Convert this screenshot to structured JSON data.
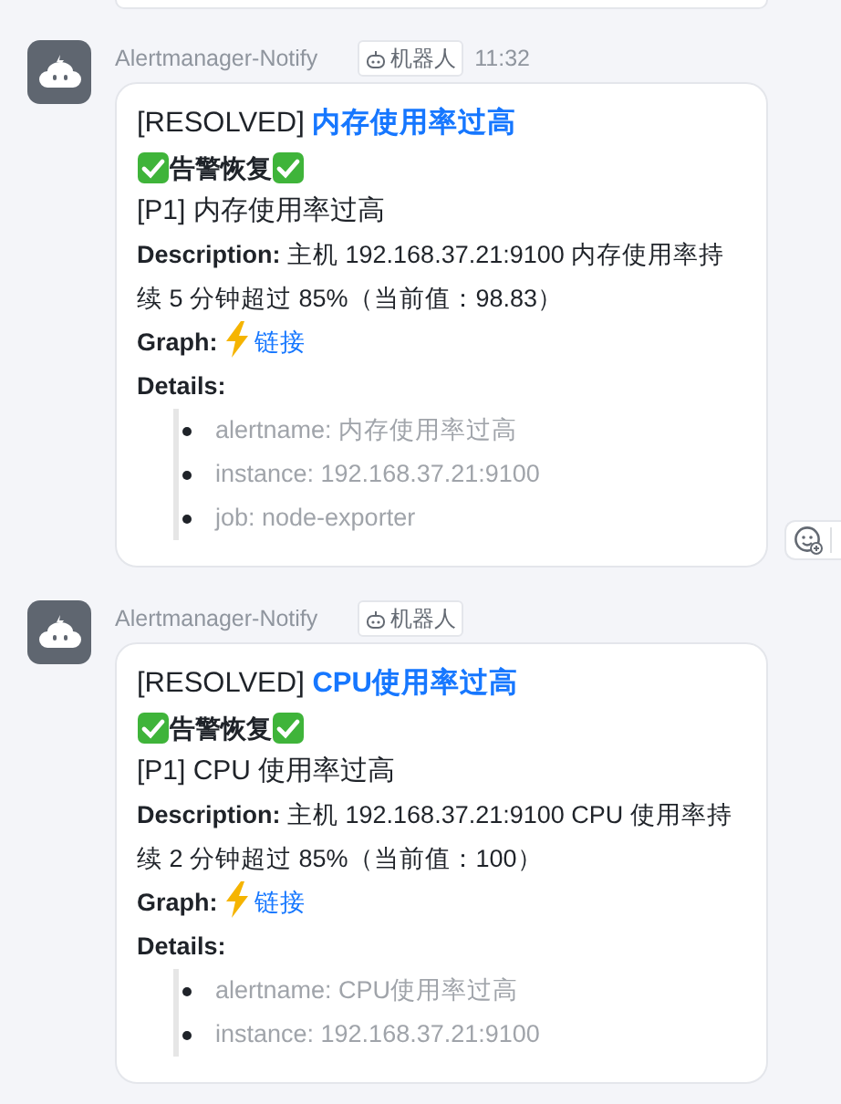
{
  "messages": [
    {
      "sender": "Alertmanager-Notify",
      "tag": "机器人",
      "time": "11:32",
      "title_prefix": "[RESOLVED]",
      "title_link": "内存使用率过高",
      "status": "告警恢复",
      "summary": "[P1] 内存使用率过高",
      "description": "**Description:** 主机 192.168.37.21:9100 内存使用率持续 5 分钟超过 85%（当前值：98.83）",
      "graph_label": "Graph:",
      "graph_link": "链接",
      "details_label": "Details:",
      "details": [
        "alertname: 内存使用率过高",
        "instance: 192.168.37.21:9100",
        "job: node-exporter"
      ],
      "reaction_button": true
    },
    {
      "sender": "Alertmanager-Notify",
      "tag": "机器人",
      "title_prefix": "[RESOLVED]",
      "title_link": "CPU使用率过高",
      "status": "告警恢复",
      "summary": "[P1] CPU 使用率过高",
      "description": "**Description:** 主机 192.168.37.21:9100 CPU 使用率持续 2 分钟超过 85%（当前值：100）",
      "graph_label": "Graph:",
      "graph_link": "链接",
      "details_label": "Details:",
      "details": [
        "alertname: CPU使用率过高",
        "instance: 192.168.37.21:9100"
      ],
      "reaction_button": false
    }
  ]
}
